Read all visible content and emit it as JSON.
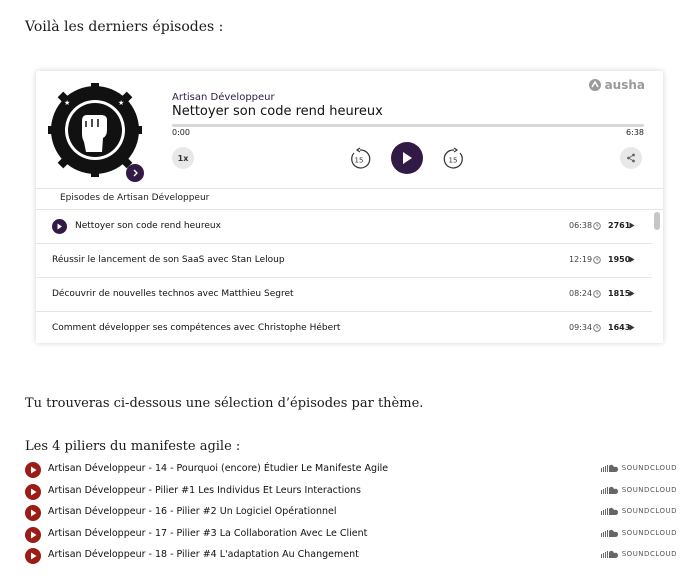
{
  "intro": "Voilà les derniers épisodes :",
  "player": {
    "brand": "ausha",
    "show_name": "Artisan Développeur",
    "episode_title": "Nettoyer son code rend heureux",
    "time_start": "0:00",
    "time_end": "6:38",
    "progress": 0,
    "speed": "1x",
    "rewind": "15",
    "forward": "15",
    "list_header": "Episodes de Artisan Développeur",
    "episodes": [
      {
        "title": "Nettoyer son code rend heureux",
        "duration": "06:38",
        "plays": "2761",
        "playing": true
      },
      {
        "title": "Réussir le lancement de son SaaS avec Stan Leloup",
        "duration": "12:19",
        "plays": "1950",
        "playing": false
      },
      {
        "title": "Découvrir de nouvelles technos avec Matthieu Segret",
        "duration": "08:24",
        "plays": "1815",
        "playing": false
      },
      {
        "title": "Comment développer ses compétences avec Christophe Hébert",
        "duration": "09:34",
        "plays": "1643",
        "playing": false
      }
    ],
    "accent_color": "#311a45"
  },
  "selection_text": "Tu trouveras ci-dessous une sélection d’épisodes par thème.",
  "pillars_heading": "Les 4 piliers du manifeste agile :",
  "soundcloud": {
    "brand_label": "SOUNDCLOUD",
    "accent_color": "#9b1d16",
    "tracks": [
      {
        "title": "Artisan Développeur - 14 - Pourquoi (encore) Étudier Le Manifeste Agile"
      },
      {
        "title": "Artisan Développeur - Pilier #1 Les Individus Et Leurs Interactions"
      },
      {
        "title": "Artisan Développeur - 16 - Pilier #2 Un Logiciel Opérationnel"
      },
      {
        "title": "Artisan Développeur - 17 - Pilier #3 La Collaboration Avec Le Client"
      },
      {
        "title": "Artisan Développeur - 18 - Pilier #4 L'adaptation Au Changement"
      }
    ]
  }
}
